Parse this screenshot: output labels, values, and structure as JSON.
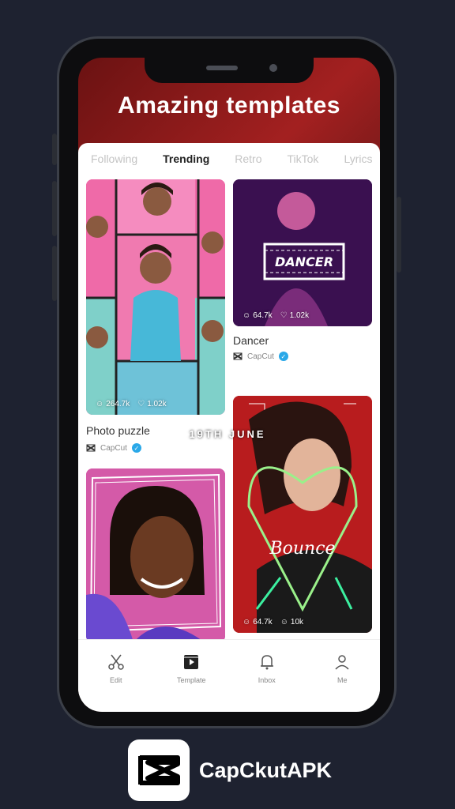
{
  "hero": {
    "title": "Amazing templates"
  },
  "tabs": [
    {
      "label": "Following"
    },
    {
      "label": "Trending"
    },
    {
      "label": "Retro"
    },
    {
      "label": "TikTok"
    },
    {
      "label": "Lyrics"
    }
  ],
  "cards": [
    {
      "title": "Photo puzzle",
      "author": "CapCut",
      "uses": "264.7k",
      "likes": "1.02k"
    },
    {
      "title": "Dancer",
      "author": "CapCut",
      "uses": "64.7k",
      "likes": "1.02k",
      "banner_text": "DANCER"
    },
    {
      "title": "",
      "author": "",
      "uses": "",
      "likes": ""
    },
    {
      "title": "",
      "author": "",
      "uses": "64.7k",
      "likes": "10k",
      "overlay_text": "Bounce"
    }
  ],
  "overlay": {
    "date_text": "19TH JUNE"
  },
  "nav": [
    {
      "label": "Edit",
      "icon": "scissors-icon"
    },
    {
      "label": "Template",
      "icon": "template-icon"
    },
    {
      "label": "Inbox",
      "icon": "bell-icon"
    },
    {
      "label": "Me",
      "icon": "user-icon"
    }
  ],
  "brand": {
    "name": "CapCkutAPK",
    "logo_icon": "capcut-logo-icon"
  },
  "colors": {
    "background": "#1e2230",
    "screen_gradient": "#a32020",
    "verified": "#2aa8e8"
  }
}
